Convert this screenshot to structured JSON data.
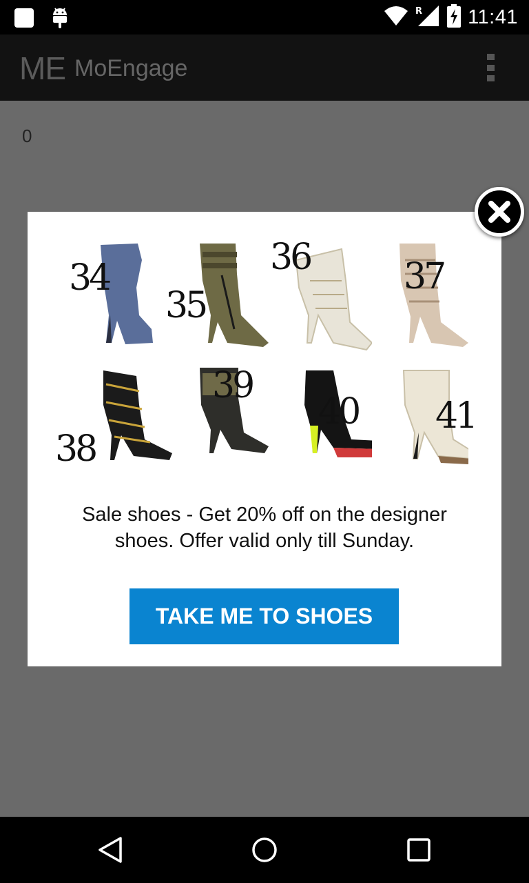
{
  "status_bar": {
    "time": "11:41",
    "icons": [
      "square-notification-icon",
      "android-icon",
      "wifi-icon",
      "signal-roaming-icon",
      "battery-charging-icon"
    ],
    "roaming_label": "R"
  },
  "app_bar": {
    "logo": "ME",
    "title": "MoEngage",
    "menu_icon": "overflow-menu-icon"
  },
  "content": {
    "counter": "0"
  },
  "dialog": {
    "close_icon": "close-icon",
    "shoes": [
      {
        "size": "34",
        "color": "#5a6e9a"
      },
      {
        "size": "35",
        "color": "#6e6a45"
      },
      {
        "size": "36",
        "color": "#e8e4d8"
      },
      {
        "size": "37",
        "color": "#d8c6b2"
      },
      {
        "size": "38",
        "color": "#1b1b1b"
      },
      {
        "size": "39",
        "color": "#2e2e2a"
      },
      {
        "size": "40",
        "color": "#141414"
      },
      {
        "size": "41",
        "color": "#ece6d6"
      }
    ],
    "message": "Sale shoes - Get 20% off on the designer shoes. Offer valid only till Sunday.",
    "cta_label": "TAKE ME TO SHOES",
    "cta_color": "#0a84d0"
  },
  "nav_bar": {
    "back_icon": "back-icon",
    "home_icon": "home-icon",
    "recents_icon": "recents-icon"
  }
}
